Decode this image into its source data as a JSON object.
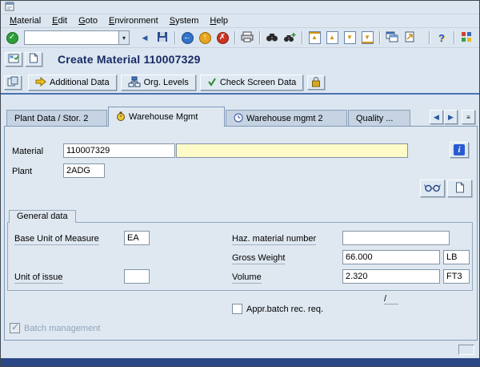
{
  "window": {
    "title": "Create Material 110007329"
  },
  "menu": {
    "items": [
      {
        "label": "Material"
      },
      {
        "label": "Edit"
      },
      {
        "label": "Goto"
      },
      {
        "label": "Environment"
      },
      {
        "label": "System"
      },
      {
        "label": "Help"
      }
    ]
  },
  "toolbar": {
    "command_value": ""
  },
  "app_toolbar": {
    "additional_data": "Additional Data",
    "org_levels": "Org. Levels",
    "check_screen_data": "Check Screen Data"
  },
  "tabs": [
    {
      "label": "Plant Data / Stor. 2",
      "active": false
    },
    {
      "label": "Warehouse Mgmt",
      "active": true
    },
    {
      "label": "Warehouse mgmt 2",
      "active": false
    },
    {
      "label": "Quality ...",
      "active": false
    }
  ],
  "form": {
    "material": {
      "label": "Material",
      "value": "110007329",
      "description_value": ""
    },
    "plant": {
      "label": "Plant",
      "value": "2ADG"
    }
  },
  "general_data": {
    "title": "General data",
    "base_unit": {
      "label": "Base Unit of Measure",
      "value": "EA"
    },
    "haz_material": {
      "label": "Haz. material number",
      "value": ""
    },
    "gross_weight": {
      "label": "Gross Weight",
      "value": "66.000",
      "unit": "LB"
    },
    "unit_of_issue": {
      "label": "Unit of issue",
      "value": ""
    },
    "volume": {
      "label": "Volume",
      "value": "2.320",
      "unit": "FT3"
    },
    "slash": "/",
    "appr_batch": {
      "label": "Appr.batch rec. req.",
      "checked": false
    },
    "batch_management": {
      "label": "Batch management",
      "checked": true,
      "disabled": true
    }
  },
  "colors": {
    "background": "#dce6f0",
    "accent_line": "#4a72b2",
    "required_field": "#fffbc8",
    "bottom_bar": "#2a4684"
  },
  "icons": {
    "check": "✓",
    "back_arrow": "←",
    "up_arrow": "↑",
    "cross": "✗",
    "dropdown": "▾",
    "left_triangle": "◀",
    "right_triangle": "▶",
    "up_triangle": "▲",
    "down_triangle": "▼",
    "question_mark": "?",
    "info_letter": "i",
    "list_lines": "≡"
  }
}
